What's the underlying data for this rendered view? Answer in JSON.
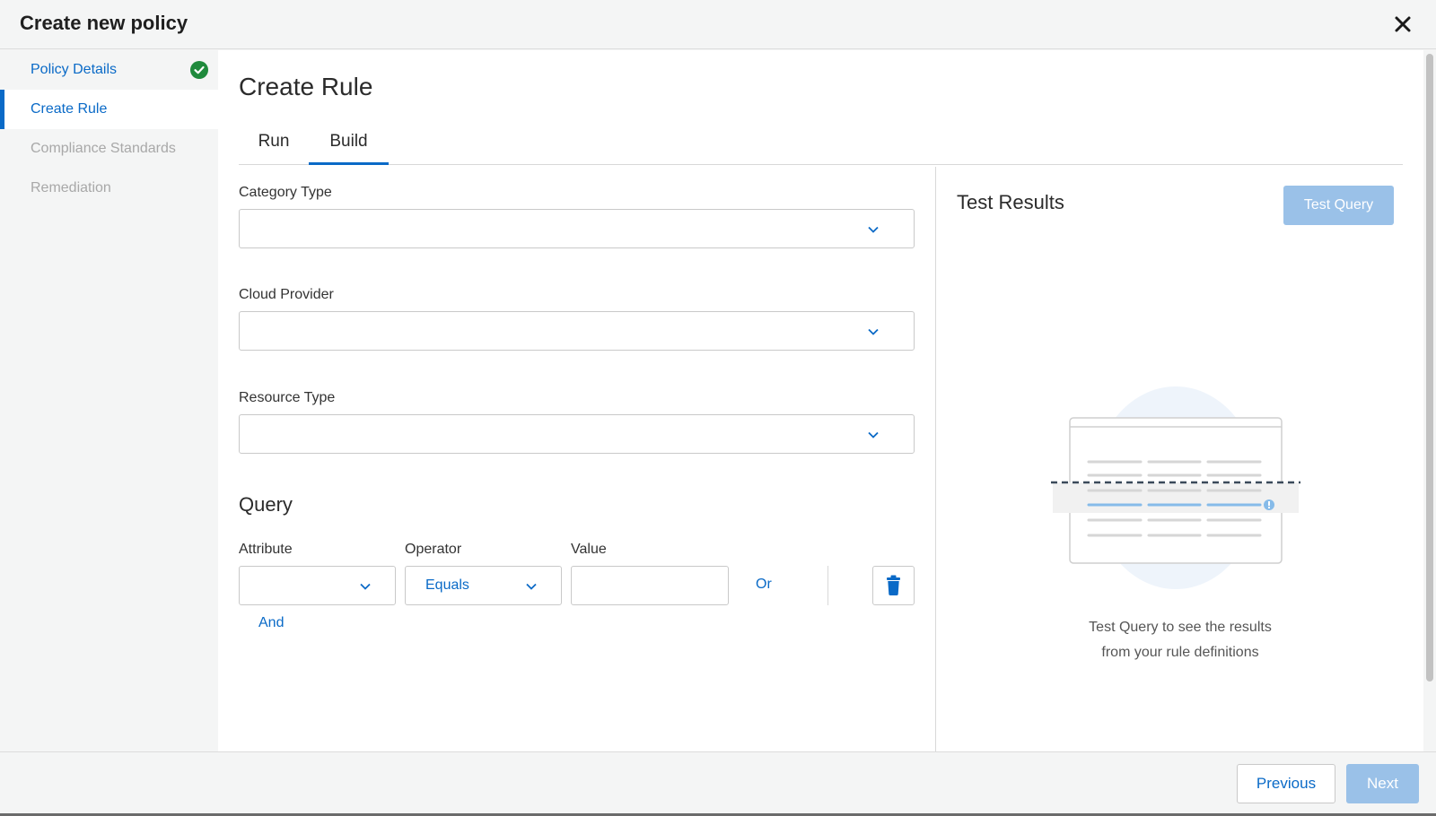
{
  "header": {
    "title": "Create new policy",
    "close_icon": "close-icon"
  },
  "sidebar": {
    "items": [
      {
        "label": "Policy Details",
        "state": "completed",
        "icon": "check-circle-icon"
      },
      {
        "label": "Create Rule",
        "state": "active"
      },
      {
        "label": "Compliance Standards",
        "state": "disabled"
      },
      {
        "label": "Remediation",
        "state": "disabled"
      }
    ]
  },
  "main": {
    "title": "Create Rule",
    "tabs": [
      {
        "label": "Run",
        "selected": false
      },
      {
        "label": "Build",
        "selected": true
      }
    ],
    "fields": {
      "category_type": {
        "label": "Category Type",
        "value": ""
      },
      "cloud_provider": {
        "label": "Cloud Provider",
        "value": ""
      },
      "resource_type": {
        "label": "Resource Type",
        "value": ""
      }
    },
    "query": {
      "title": "Query",
      "attribute_label": "Attribute",
      "operator_label": "Operator",
      "value_label": "Value",
      "attribute_value": "",
      "operator_value": "Equals",
      "value_value": "",
      "or_label": "Or",
      "and_label": "And",
      "delete_icon": "trash-icon"
    }
  },
  "results": {
    "title": "Test Results",
    "test_button": "Test Query",
    "empty_line1": "Test Query to see the results",
    "empty_line2": "from your rule definitions"
  },
  "footer": {
    "previous_label": "Previous",
    "next_label": "Next"
  },
  "colors": {
    "accent": "#0a6ac7",
    "disabled_button": "#9ac1e8",
    "success": "#1f8a3c",
    "disabled_text": "#a8a8a8"
  }
}
